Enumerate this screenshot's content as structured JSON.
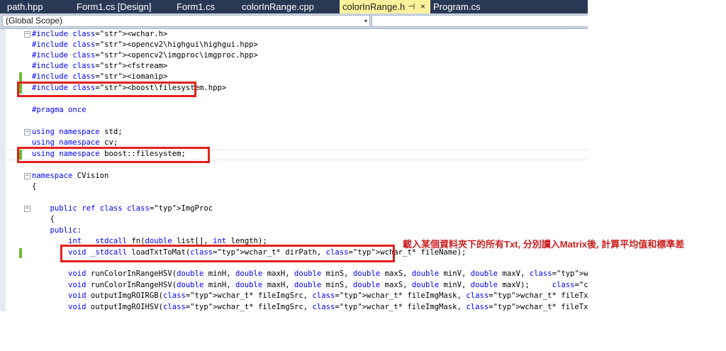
{
  "tabs": [
    {
      "label": "path.hpp",
      "active": false
    },
    {
      "label": "Form1.cs [Design]",
      "active": false
    },
    {
      "label": "Form1.cs",
      "active": false
    },
    {
      "label": "colorInRange.cpp",
      "active": false
    },
    {
      "label": "colorInRange.h",
      "active": true,
      "pin_icon": "⊣",
      "close_icon": "×"
    },
    {
      "label": "Program.cs",
      "active": false
    }
  ],
  "navbar": {
    "scope_value": "(Global Scope)"
  },
  "code_lines": [
    "#include <wchar.h>",
    "#include <opencv2\\highgui\\highgui.hpp>",
    "#include <opencv2\\imgproc\\imgproc.hpp>",
    "#include <fstream>",
    "#include <iomanip>",
    "#include <boost\\filesystem.hpp>",
    "",
    "#pragma once",
    "",
    "using namespace std;",
    "using namespace cv;",
    "using namespace boost::filesystem;",
    "",
    "namespace CVision",
    "{",
    "",
    "    public ref class ImgProc",
    "    {",
    "    public:",
    "        int __stdcall fn(double list[], int length);",
    "        void _stdcall loadTxtToMat(wchar_t* dirPath, wchar_t* fileName);",
    "",
    "        void runColorInRangeHSV(double minH, double maxH, double minS, double maxS, double minV, double maxV, wchar_t",
    "        void runColorInRangeHSV(double minH, double maxH, double minS, double maxS, double minV, double maxV);     //",
    "        void outputImgROIRGB(wchar_t* fileImgSrc, wchar_t* fileImgMask, wchar_t* fileTxtDstR, wchar_t* fileTxtDstG, w",
    "        void outputImgROIHSV(wchar_t* fileImgSrc, wchar_t* fileImgMask, wchar_t* fileTxtDstH, wchar_t* fileTxtDstS, w"
  ],
  "annotation": "載入某個資料夾下的所有Txt, 分別讀入Matrix後, 計算平均值和標準差",
  "colors": {
    "tab_bar": "#293955",
    "active_tab": "#fff29d",
    "highlight_box": "#e2201c",
    "annotation": "#cc1e1e",
    "keyword": "#0000ff",
    "type": "#2b91af",
    "string": "#a31515"
  },
  "icons": {
    "dropdown": "▾",
    "fold_open": "−"
  }
}
